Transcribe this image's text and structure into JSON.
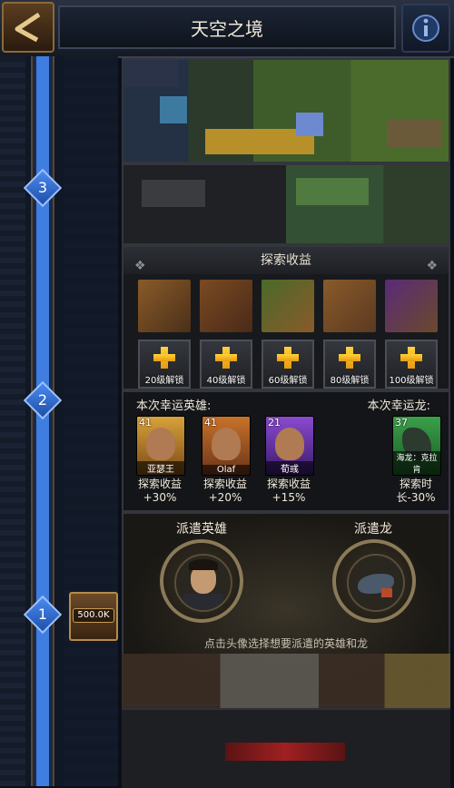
{
  "header": {
    "title": "天空之境"
  },
  "progress": {
    "milestones": [
      "1",
      "2",
      "3"
    ],
    "reward_label": "500.0K"
  },
  "explore": {
    "title": "探索收益",
    "slots": [
      "20级解锁",
      "40级解锁",
      "60级解锁",
      "80级解锁",
      "100级解锁"
    ]
  },
  "lucky": {
    "hero_heading": "本次幸运英雄:",
    "dragon_heading": "本次幸运龙:",
    "heroes": [
      {
        "level": "41",
        "name": "亚瑟王",
        "bonus_label": "探索收益",
        "bonus_value": "+30%",
        "color": "#b8861f"
      },
      {
        "level": "41",
        "name": "Olaf",
        "bonus_label": "探索收益",
        "bonus_value": "+20%",
        "color": "#b8571f"
      },
      {
        "level": "21",
        "name": "荀彧",
        "bonus_label": "探索收益",
        "bonus_value": "+15%",
        "color": "#6b2fa8"
      }
    ],
    "dragon": {
      "level": "37",
      "name": "海龙：克拉肯",
      "bonus_label": "探索时",
      "bonus_value": "长-30%",
      "color": "#2f8a3a"
    }
  },
  "dispatch": {
    "hero_label": "派遣英雄",
    "dragon_label": "派遣龙",
    "hint": "点击头像选择想要派遣的英雄和龙"
  },
  "progress_fill": 1.0
}
